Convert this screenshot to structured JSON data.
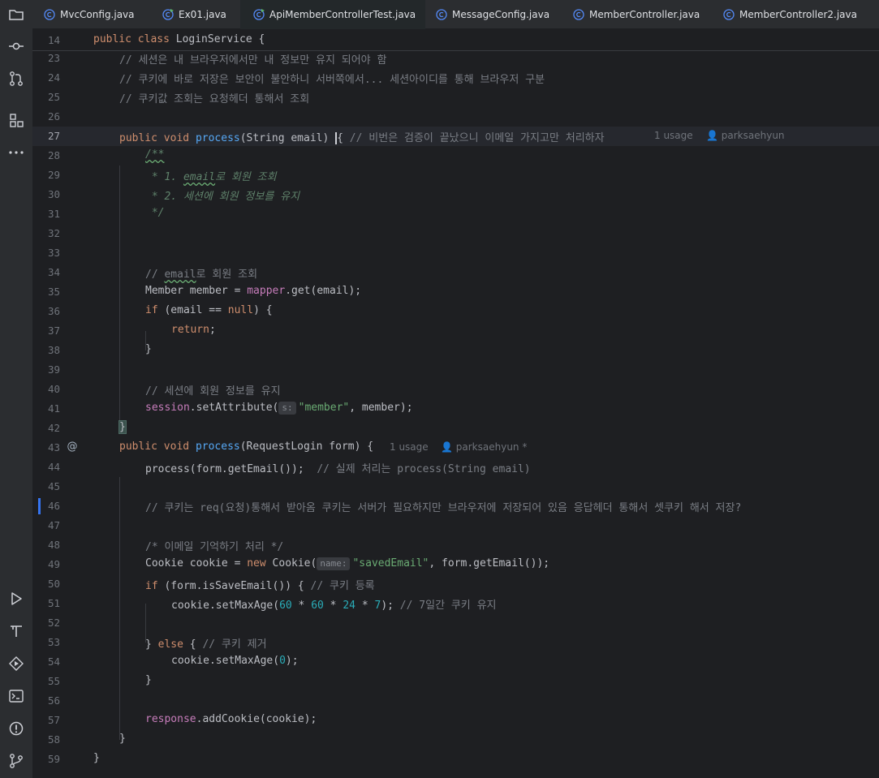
{
  "tabs": [
    {
      "label": "MvcConfig.java",
      "active": false
    },
    {
      "label": "Ex01.java",
      "active": false
    },
    {
      "label": "ApiMemberControllerTest.java",
      "active": true
    },
    {
      "label": "MessageConfig.java",
      "active": false
    },
    {
      "label": "MemberController.java",
      "active": false
    },
    {
      "label": "MemberController2.java",
      "active": false
    }
  ],
  "sticky": {
    "line": "14",
    "text": "public class LoginService {"
  },
  "lines": [
    {
      "n": "23",
      "c1": "// 세션은 내 브라우저에서만 내 정보만 유지 되어야 함"
    },
    {
      "n": "24",
      "c1": "// 쿠키에 바로 저장은 보안이 불안하니 서버쪽에서... 세션아이디를 통해 브라우저 구분"
    },
    {
      "n": "25",
      "c1": "// 쿠키값 조회는 요청헤더 통해서 조회"
    },
    {
      "n": "26"
    },
    {
      "n": "27",
      "k1": "public",
      "k2": "void",
      "fn": "process",
      "params": "(String email) ",
      "brace": "{",
      "comment": " // 비번은 검증이 끝났으니 이메일 가지고만 처리하자",
      "usage": "1 usage",
      "author": "parksaehyun"
    },
    {
      "n": "28",
      "c1": "/**"
    },
    {
      "n": "29",
      "c1": " * 1. ",
      "c2": "email",
      "c3": "로 회원 조회"
    },
    {
      "n": "30",
      "c1": " * 2. 세션에 회원 정보를 유지"
    },
    {
      "n": "31",
      "c1": " */"
    },
    {
      "n": "32"
    },
    {
      "n": "33"
    },
    {
      "n": "34",
      "c1": "// ",
      "c2": "email",
      "c3": "로 회원 조회"
    },
    {
      "n": "35",
      "t1": "Member member = ",
      "f1": "mapper",
      "t2": ".get(email);"
    },
    {
      "n": "36",
      "k1": "if",
      "t1": " (email == ",
      "k2": "null",
      "t2": ") {"
    },
    {
      "n": "37",
      "k1": "return",
      "t1": ";"
    },
    {
      "n": "38",
      "t1": "}"
    },
    {
      "n": "39"
    },
    {
      "n": "40",
      "c1": "// 세션에 회원 정보를 유지"
    },
    {
      "n": "41",
      "f1": "session",
      "t1": ".setAttribute(",
      "hint": "s:",
      "s1": "\"member\"",
      "t2": ", member);"
    },
    {
      "n": "42",
      "t1": "}"
    },
    {
      "n": "43",
      "k1": "public",
      "k2": "void",
      "fn": "process",
      "t1": "(RequestLogin form) {",
      "usage": "1 usage",
      "author": "parksaehyun *"
    },
    {
      "n": "44",
      "t1": "process(form.getEmail());  ",
      "c1": "// 실제 처리는 process(String email)"
    },
    {
      "n": "45"
    },
    {
      "n": "46",
      "c1": "// 쿠키는 req(요청)통해서 받아옴 쿠키는 서버가 필요하지만 브라우저에 저장되어 있음 응답헤더 통해서 셋쿠키 해서 저장?"
    },
    {
      "n": "47"
    },
    {
      "n": "48",
      "c1": "/* 이메일 기억하기 처리 */"
    },
    {
      "n": "49",
      "t1": "Cookie cookie = ",
      "k1": "new",
      "t2": " Cookie(",
      "hint": "name:",
      "s1": "\"savedEmail\"",
      "t3": ", form.getEmail());"
    },
    {
      "n": "50",
      "k1": "if",
      "t1": " (form.isSaveEmail()) { ",
      "c1": "// 쿠키 등록"
    },
    {
      "n": "51",
      "t1": "cookie.setMaxAge(",
      "n1": "60",
      "t2": " * ",
      "n2": "60",
      "t3": " * ",
      "n3": "24",
      "t4": " * ",
      "n4": "7",
      "t5": "); ",
      "c1": "// 7일간 쿠키 유지"
    },
    {
      "n": "52"
    },
    {
      "n": "53",
      "t1": "} ",
      "k1": "else",
      "t2": " { ",
      "c1": "// 쿠키 제거"
    },
    {
      "n": "54",
      "t1": "cookie.setMaxAge(",
      "n1": "0",
      "t2": ");"
    },
    {
      "n": "55",
      "t1": "}"
    },
    {
      "n": "56"
    },
    {
      "n": "57",
      "f1": "response",
      "t1": ".addCookie(cookie);"
    },
    {
      "n": "58",
      "t1": "}"
    },
    {
      "n": "59",
      "t1": "}"
    }
  ],
  "gutter_marker": "@",
  "colors": {
    "background": "#1e1f22",
    "keyword": "#cf8e6d",
    "function": "#56a8f5",
    "field": "#c77dbb",
    "string": "#6aab73",
    "number": "#2aacb8",
    "comment": "#7a7e85",
    "doc": "#5f826b",
    "caret_line": "#26282e"
  },
  "toolbar_icons": [
    "project-folder-icon",
    "commit-icon",
    "pull-request-icon",
    "structure-icon",
    "more-icon",
    "run-icon",
    "build-icon",
    "services-icon",
    "terminal-icon",
    "problems-icon",
    "git-icon"
  ]
}
